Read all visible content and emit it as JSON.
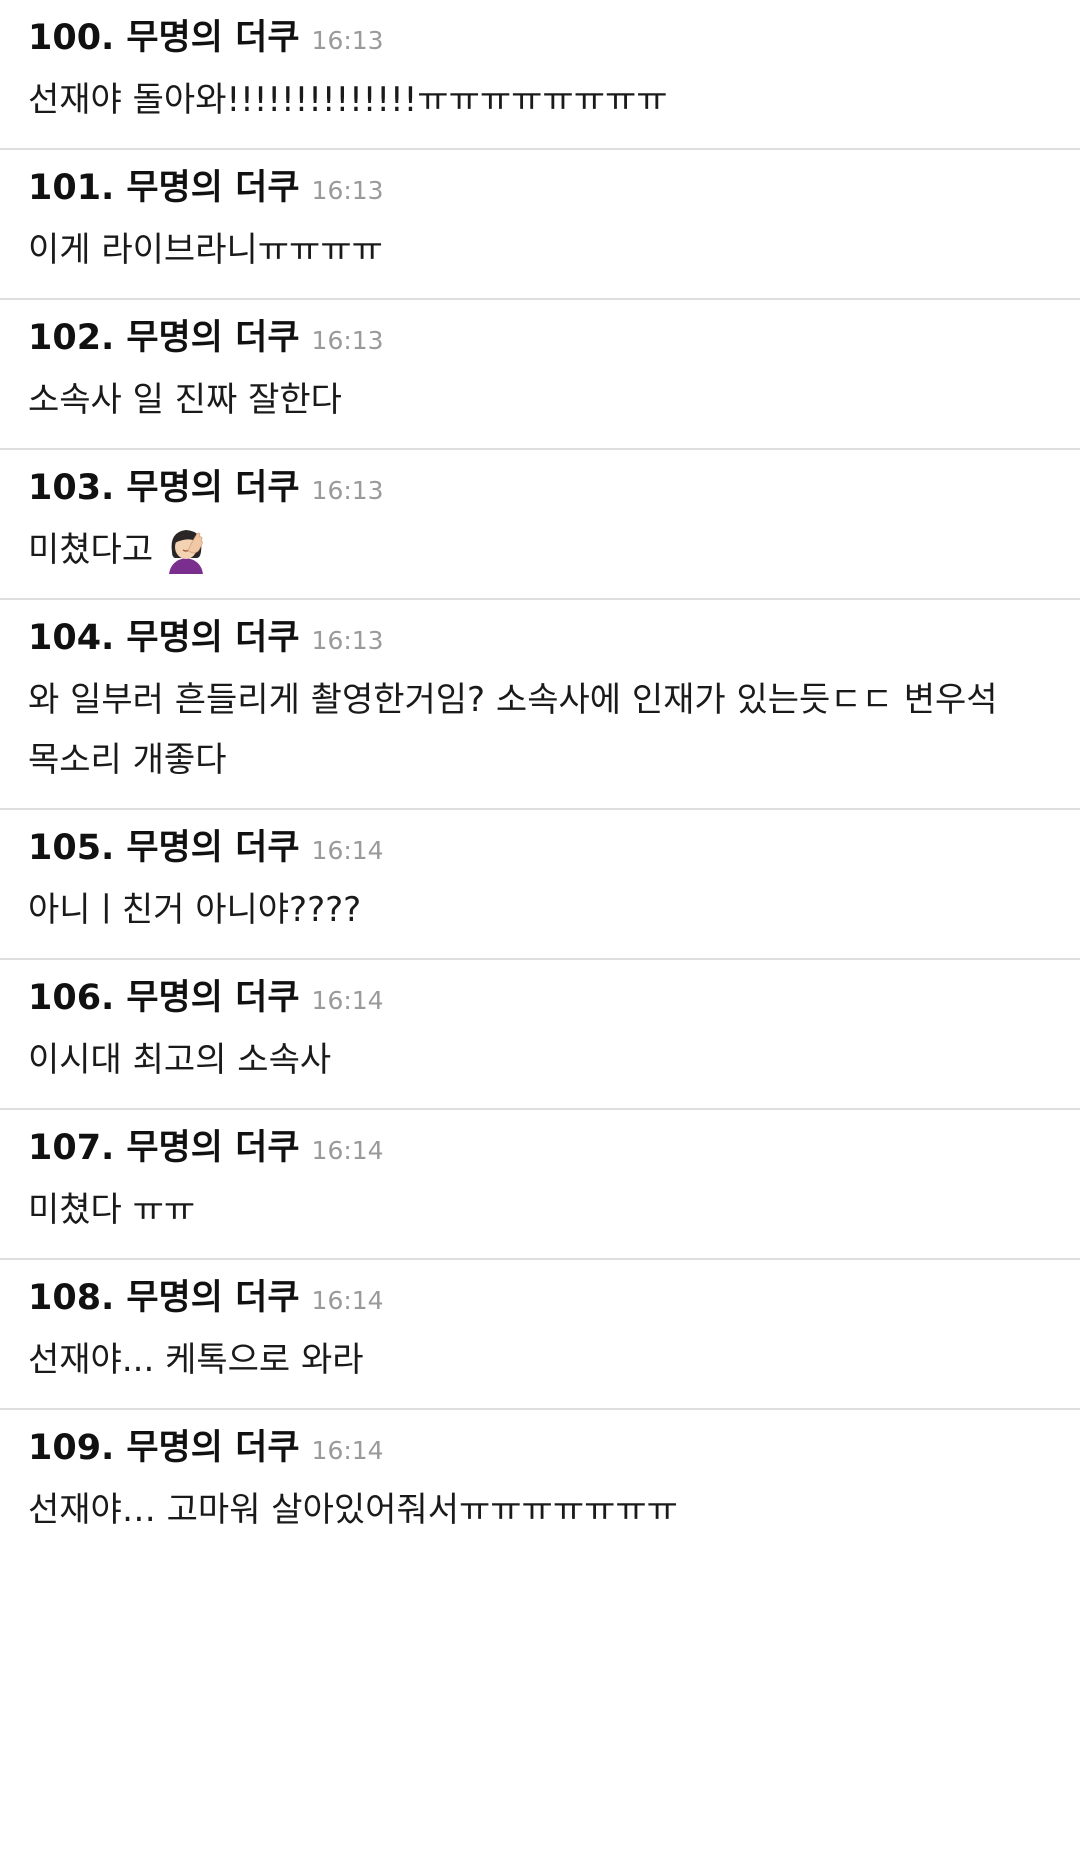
{
  "comments": [
    {
      "no": "100.",
      "author": "무명의 더쿠",
      "time": "16:13",
      "text": "선재야 돌아와!!!!!!!!!!!!!!ㅠㅠㅠㅠㅠㅠㅠㅠ"
    },
    {
      "no": "101.",
      "author": "무명의 더쿠",
      "time": "16:13",
      "text": "이게 라이브라니ㅠㅠㅠㅠ"
    },
    {
      "no": "102.",
      "author": "무명의 더쿠",
      "time": "16:13",
      "text": "소속사 일 진짜 잘한다"
    },
    {
      "no": "103.",
      "author": "무명의 더쿠",
      "time": "16:13",
      "text": "미쳤다고",
      "emoji": "facepalm-woman-icon"
    },
    {
      "no": "104.",
      "author": "무명의 더쿠",
      "time": "16:13",
      "text": "와 일부러 흔들리게 촬영한거임? 소속사에 인재가 있는듯ㄷㄷ 변우석 목소리 개좋다"
    },
    {
      "no": "105.",
      "author": "무명의 더쿠",
      "time": "16:14",
      "text": "아니ㅣ친거 아니야????"
    },
    {
      "no": "106.",
      "author": "무명의 더쿠",
      "time": "16:14",
      "text": "이시대 최고의 소속사"
    },
    {
      "no": "107.",
      "author": "무명의 더쿠",
      "time": "16:14",
      "text": "미쳤다 ㅠㅠ"
    },
    {
      "no": "108.",
      "author": "무명의 더쿠",
      "time": "16:14",
      "text": "선재야... 케톡으로 와라"
    },
    {
      "no": "109.",
      "author": "무명의 더쿠",
      "time": "16:14",
      "text": "선재야… 고마워 살아있어줘서ㅠㅠㅠㅠㅠㅠㅠ"
    }
  ],
  "colors": {
    "text": "#111111",
    "time": "#9a9a9a",
    "divider": "#dedede",
    "background": "#ffffff"
  }
}
